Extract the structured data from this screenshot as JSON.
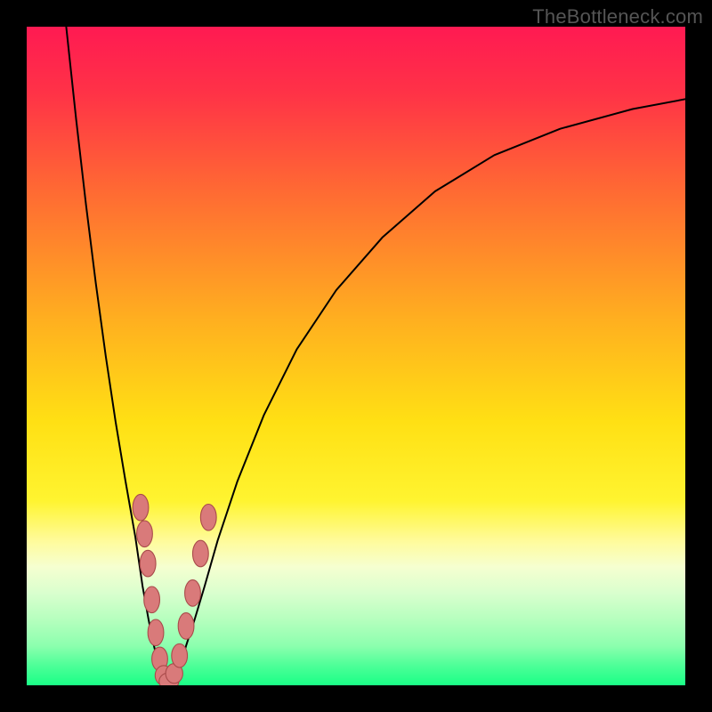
{
  "watermark": "TheBottleneck.com",
  "colors": {
    "black": "#000000",
    "curve": "#000000",
    "marker_fill": "#d97a7a",
    "marker_stroke": "#a94b4b"
  },
  "chart_data": {
    "type": "line",
    "title": "",
    "xlabel": "",
    "ylabel": "",
    "xlim": [
      0,
      100
    ],
    "ylim": [
      0,
      100
    ],
    "grid": false,
    "legend": false,
    "gradient_stops": [
      {
        "offset": 0.0,
        "color": "#ff1a52"
      },
      {
        "offset": 0.1,
        "color": "#ff3247"
      },
      {
        "offset": 0.25,
        "color": "#ff6a33"
      },
      {
        "offset": 0.45,
        "color": "#ffb11f"
      },
      {
        "offset": 0.6,
        "color": "#ffe014"
      },
      {
        "offset": 0.72,
        "color": "#fff430"
      },
      {
        "offset": 0.78,
        "color": "#fffb9a"
      },
      {
        "offset": 0.82,
        "color": "#f6ffd0"
      },
      {
        "offset": 0.86,
        "color": "#d9ffce"
      },
      {
        "offset": 0.9,
        "color": "#b6ffbe"
      },
      {
        "offset": 0.94,
        "color": "#8cffae"
      },
      {
        "offset": 0.97,
        "color": "#4dff98"
      },
      {
        "offset": 1.0,
        "color": "#1aff86"
      }
    ],
    "series": [
      {
        "name": "left",
        "x": [
          6.0,
          7.5,
          9.0,
          10.5,
          12.0,
          13.5,
          15.0,
          16.5,
          17.6,
          18.5,
          19.2,
          19.8,
          20.3,
          20.8,
          21.2
        ],
        "y": [
          100.0,
          86.0,
          73.0,
          61.0,
          50.0,
          40.0,
          31.0,
          22.5,
          15.0,
          10.0,
          6.5,
          4.0,
          2.2,
          1.0,
          0.3
        ]
      },
      {
        "name": "right",
        "x": [
          22.0,
          22.6,
          23.3,
          24.2,
          25.5,
          27.0,
          29.0,
          32.0,
          36.0,
          41.0,
          47.0,
          54.0,
          62.0,
          71.0,
          81.0,
          92.0,
          100.0
        ],
        "y": [
          0.3,
          1.2,
          3.0,
          6.0,
          10.0,
          15.0,
          22.0,
          31.0,
          41.0,
          51.0,
          60.0,
          68.0,
          75.0,
          80.5,
          84.5,
          87.5,
          89.0
        ]
      }
    ],
    "floor_line": {
      "y": 0.0,
      "x": [
        21.2,
        22.0
      ]
    },
    "markers": [
      {
        "x": 17.3,
        "y": 27.0,
        "rx": 1.2,
        "ry": 2.0
      },
      {
        "x": 17.9,
        "y": 23.0,
        "rx": 1.2,
        "ry": 2.0
      },
      {
        "x": 18.4,
        "y": 18.5,
        "rx": 1.2,
        "ry": 2.0
      },
      {
        "x": 19.0,
        "y": 13.0,
        "rx": 1.2,
        "ry": 2.0
      },
      {
        "x": 19.6,
        "y": 8.0,
        "rx": 1.2,
        "ry": 2.0
      },
      {
        "x": 20.2,
        "y": 4.0,
        "rx": 1.2,
        "ry": 1.8
      },
      {
        "x": 20.8,
        "y": 1.5,
        "rx": 1.3,
        "ry": 1.5
      },
      {
        "x": 21.6,
        "y": 0.6,
        "rx": 1.5,
        "ry": 1.3
      },
      {
        "x": 22.4,
        "y": 1.8,
        "rx": 1.3,
        "ry": 1.5
      },
      {
        "x": 23.2,
        "y": 4.5,
        "rx": 1.2,
        "ry": 1.8
      },
      {
        "x": 24.2,
        "y": 9.0,
        "rx": 1.2,
        "ry": 2.0
      },
      {
        "x": 25.2,
        "y": 14.0,
        "rx": 1.2,
        "ry": 2.0
      },
      {
        "x": 26.4,
        "y": 20.0,
        "rx": 1.2,
        "ry": 2.0
      },
      {
        "x": 27.6,
        "y": 25.5,
        "rx": 1.2,
        "ry": 2.0
      }
    ]
  }
}
